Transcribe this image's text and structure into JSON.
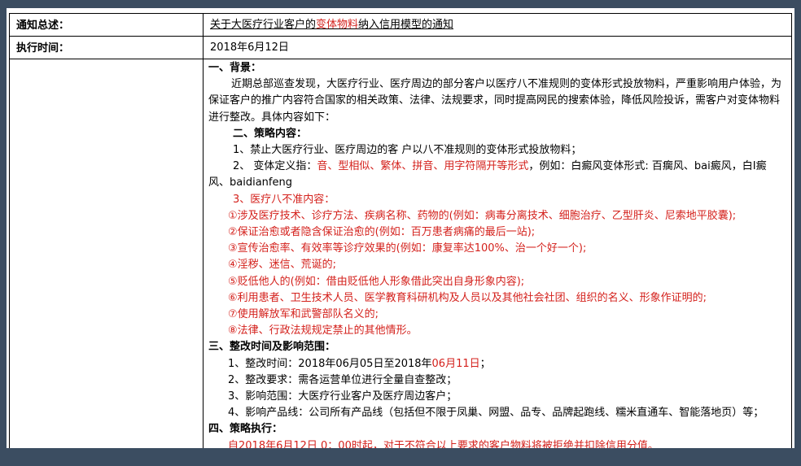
{
  "rows": {
    "notice_label": "通知总述：",
    "notice_value_pre": "关于大医疗行业客户的",
    "notice_value_red": "变体物料",
    "notice_value_post": "纳入信用模型的通知",
    "time_label": "执行时间：",
    "time_value": "2018年6月12日"
  },
  "content": {
    "s1_title": "一、背景：",
    "s1_text": "近期总部巡查发现，大医疗行业、医疗周边的部分客户以医疗八不准规则的变体形式投放物料，严重影响用户体验，为保证客户的推广内容符合国家的相关政策、法律、法规要求，同时提高网民的搜索体验，降低风险投诉，需客户对变体物料进行整改。具体内容如下：",
    "s2_title": "二、策略内容：",
    "s2_item1": "1、禁止大医疗行业、医疗周边的客 户以八不准规则的变体形式投放物料；",
    "s2_item2_pre": "2、 变体定义指：",
    "s2_item2_red": "音、型相似、繁体、拼音、用字符隔开等形式",
    "s2_item2_post": "，例如：白癜风变体形式: 百瘸风、bai癜风，白I癜风、baidianfeng",
    "s2_item3": "3、医疗八不准内容：",
    "rules": [
      "①涉及医疗技术、诊疗方法、疾病名称、药物的(例如：病毒分离技术、细胞治疗、乙型肝炎、尼索地平胶囊);",
      "②保证治愈或者隐含保证治愈的(例如：百万患者病痛的最后一站);",
      "③宣传治愈率、有效率等诊疗效果的(例如：康复率达100%、治一个好一个);",
      "④淫秽、迷信、荒诞的;",
      "⑤贬低他人的(例如：借由贬低他人形象借此突出自身形象内容);",
      "⑥利用患者、卫生技术人员、医学教育科研机构及人员以及其他社会社团、组织的名义、形象作证明的;",
      "⑦使用解放军和武警部队名义的;",
      "⑧法律、行政法规规定禁止的其他情形。"
    ],
    "s3_title": "三、整改时间及影响范围：",
    "s3_item1_pre": "1、整改时间：2018年06月05日至2018年",
    "s3_item1_red": "06月11日",
    "s3_item1_post": "；",
    "s3_item2": "2、整改要求：需各运营单位进行全量自查整改；",
    "s3_item3": "3、影响范围：大医疗行业客户及医疗周边客户；",
    "s3_item4": "4、影响产品线：公司所有产品线（包括但不限于凤巢、网盟、品专、品牌起跑线、糯米直通车、智能落地页）等；",
    "s4_title": "四、策略执行：",
    "s4_text": "自2018年6月12日 0：00时起，对于不符合以上要求的客户物料将被拒绝并扣除信用分值。"
  },
  "colors": {
    "frame": "#3b4d61",
    "highlight_red": "#d4211c"
  }
}
